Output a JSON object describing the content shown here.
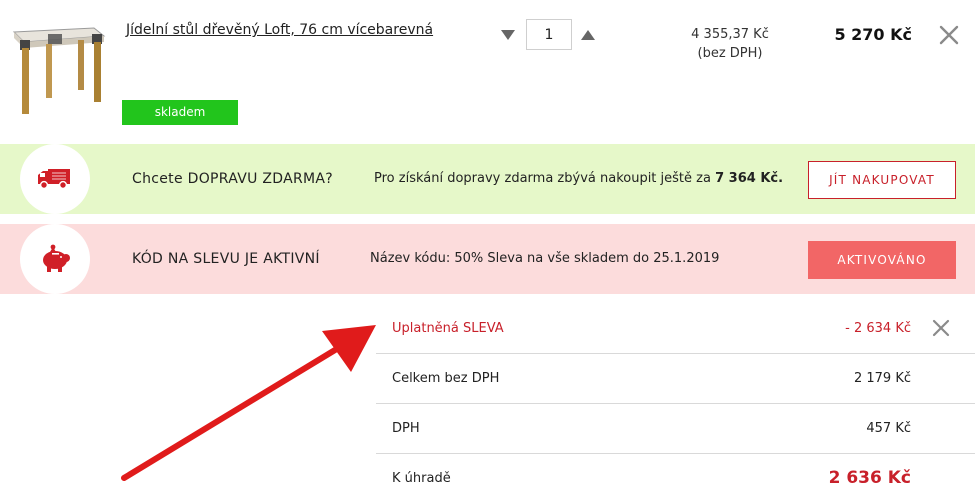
{
  "product": {
    "name": "Jídelní stůl dřevěný Loft, 76 cm vícebarevná",
    "stock_badge": "skladem",
    "quantity": "1",
    "unit_price": "4 355,37 Kč",
    "unit_price_note": "(bez DPH)",
    "total_price": "5 270 Kč"
  },
  "shipping_banner": {
    "icon": "delivery-truck-icon",
    "title": "Chcete DOPRAVU ZDARMA?",
    "desc_prefix": "Pro získání dopravy zdarma zbývá nakoupit ještě za",
    "desc_amount": "7 364 Kč.",
    "button_label": "JÍT NAKUPOVAT"
  },
  "code_banner": {
    "icon": "piggy-bank-icon",
    "title": "KÓD NA SLEVU JE AKTIVNÍ",
    "desc": "Název kódu: 50% Sleva na vše skladem do 25.1.2019",
    "button_label": "AKTIVOVÁNO"
  },
  "summary": {
    "discount_label": "Uplatněná SLEVA",
    "discount_value": "- 2 634 Kč",
    "net_label": "Celkem bez DPH",
    "net_value": "2 179 Kč",
    "vat_label": "DPH",
    "vat_value": "457 Kč",
    "total_label": "K úhradě",
    "total_value": "2 636 Kč"
  },
  "colors": {
    "accent_red": "#c8202a",
    "badge_green": "#22c51c",
    "shipping_bg": "#e6f8c9",
    "code_bg": "#fcdcdc",
    "activated_button": "#f26666",
    "annotation_arrow": "#e01b1b"
  }
}
